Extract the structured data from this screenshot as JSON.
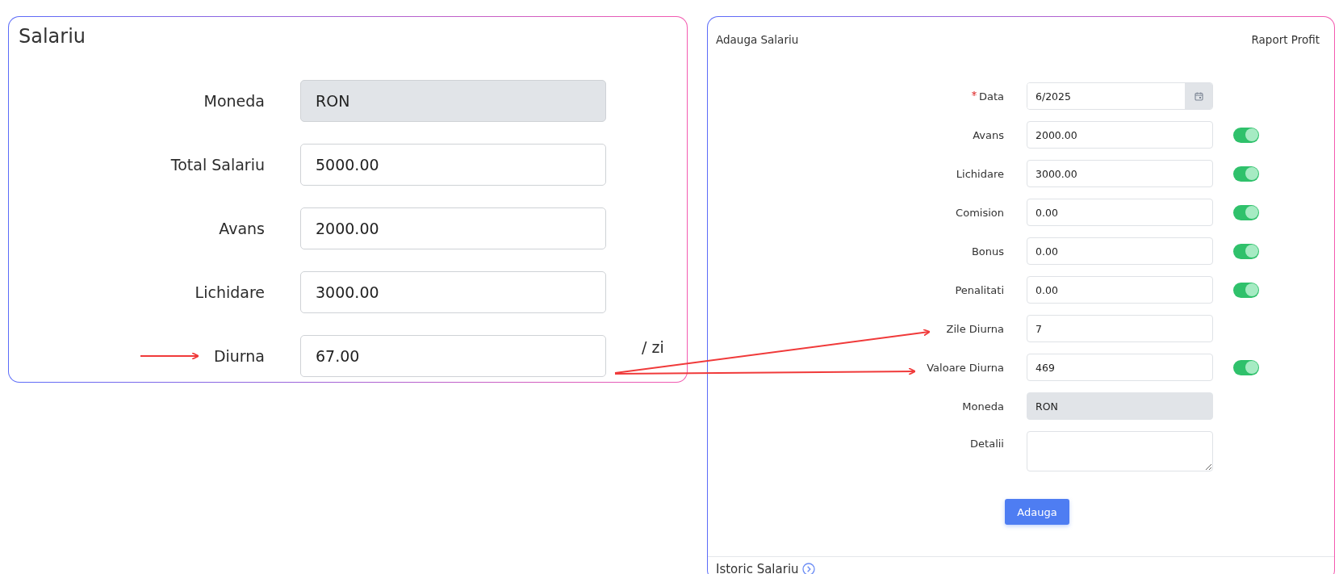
{
  "salary_summary": {
    "title": "Salariu",
    "rows": [
      {
        "label": "Moneda",
        "value": "RON",
        "kind": "readonly"
      },
      {
        "label": "Total Salariu",
        "value": "5000.00",
        "kind": "input"
      },
      {
        "label": "Avans",
        "value": "2000.00",
        "kind": "input"
      },
      {
        "label": "Lichidare",
        "value": "3000.00",
        "kind": "input"
      },
      {
        "label": "Diurna",
        "value": "67.00",
        "kind": "input",
        "suffix": "/ zi"
      }
    ]
  },
  "add_salary": {
    "title": "Adauga Salariu",
    "report_link": "Raport Profit",
    "fields": [
      {
        "label": "Data",
        "value": "6/2025",
        "kind": "date",
        "required": true
      },
      {
        "label": "Avans",
        "value": "2000.00",
        "kind": "input",
        "required": false,
        "on": true
      },
      {
        "label": "Lichidare",
        "value": "3000.00",
        "kind": "input",
        "required": false,
        "on": true
      },
      {
        "label": "Comision",
        "value": "0.00",
        "kind": "input",
        "required": false,
        "on": true
      },
      {
        "label": "Bonus",
        "value": "0.00",
        "kind": "input",
        "required": false,
        "on": true
      },
      {
        "label": "Penalitati",
        "value": "0.00",
        "kind": "input",
        "required": false,
        "on": true
      },
      {
        "label": "Zile Diurna",
        "value": "7",
        "kind": "input",
        "required": false
      },
      {
        "label": "Valoare Diurna",
        "value": "469",
        "kind": "input",
        "required": false,
        "on": true
      },
      {
        "label": "Moneda",
        "value": "RON",
        "kind": "readonly",
        "required": false
      },
      {
        "label": "Detalii",
        "kind": "textarea",
        "required": false
      }
    ],
    "submit_button": "Adauga",
    "history_title": "Istoric Salariu"
  }
}
